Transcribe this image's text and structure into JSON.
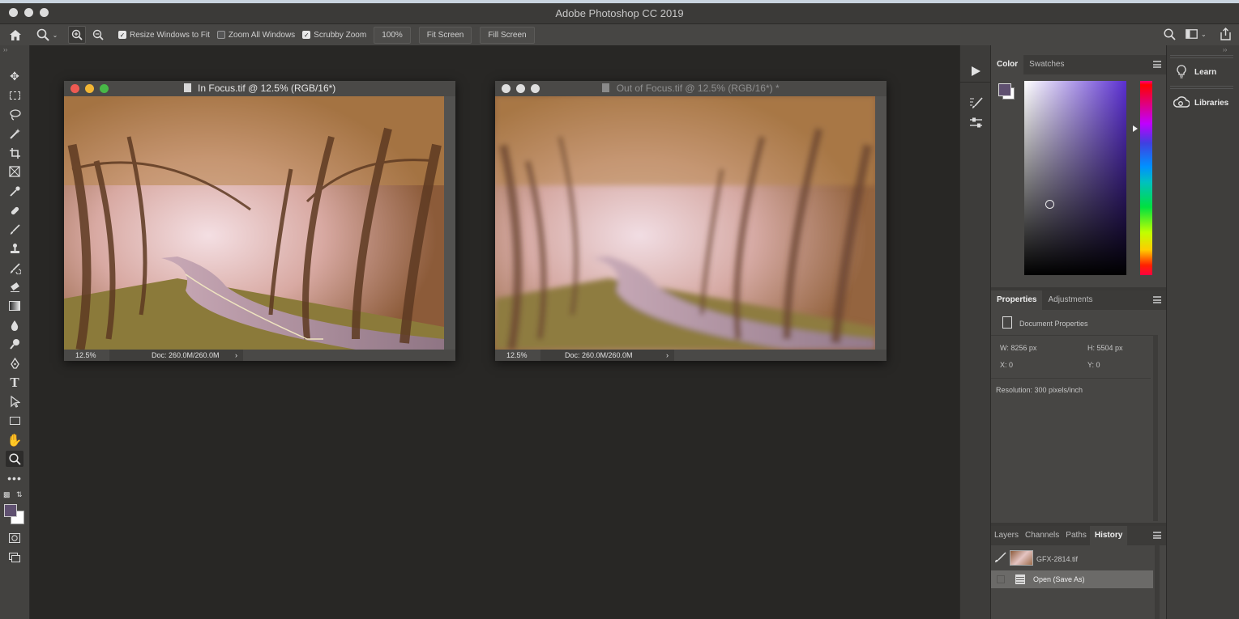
{
  "window": {
    "title": "Adobe Photoshop CC 2019"
  },
  "options_bar": {
    "home_icon": "home-icon",
    "zoom_tool_icon": "zoom-tool-icon",
    "zoom_in_icon": "zoom-in-icon",
    "zoom_out_icon": "zoom-out-icon",
    "resize_windows_label": "Resize Windows to Fit",
    "resize_windows_checked": true,
    "zoom_all_label": "Zoom All Windows",
    "zoom_all_checked": false,
    "scrubby_zoom_label": "Scrubby Zoom",
    "scrubby_zoom_checked": true,
    "zoom_100_label": "100%",
    "fit_screen_label": "Fit Screen",
    "fill_screen_label": "Fill Screen"
  },
  "documents": [
    {
      "title": "In Focus.tif @ 12.5% (RGB/16*)",
      "zoom": "12.5%",
      "doc_size": "Doc: 260.0M/260.0M",
      "blurred": false,
      "active": true
    },
    {
      "title": "Out of Focus.tif @ 12.5% (RGB/16*) *",
      "zoom": "12.5%",
      "doc_size": "Doc: 260.0M/260.0M",
      "blurred": true,
      "active": false
    }
  ],
  "color_panel": {
    "tabs": [
      "Color",
      "Swatches"
    ],
    "active_tab": "Color",
    "foreground_color": "#5f5070",
    "background_color": "#ffffff",
    "hue_color": "#5a2fd0"
  },
  "properties_panel": {
    "tabs": [
      "Properties",
      "Adjustments"
    ],
    "active_tab": "Properties",
    "doc_label": "Document Properties",
    "width": "W: 8256 px",
    "height": "H: 5504 px",
    "x": "X: 0",
    "y": "Y: 0",
    "resolution": "Resolution: 300 pixels/inch"
  },
  "history_panel": {
    "tabs": [
      "Layers",
      "Channels",
      "Paths",
      "History"
    ],
    "active_tab": "History",
    "snapshot_label": "GFX-2814.tif",
    "items": [
      "Open (Save As)"
    ]
  },
  "far_panel": {
    "learn_label": "Learn",
    "libraries_label": "Libraries"
  }
}
